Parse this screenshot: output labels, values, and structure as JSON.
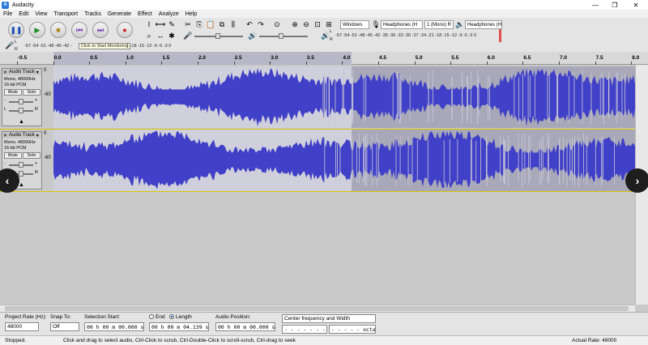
{
  "window": {
    "title": "Audacity",
    "app_icon": "audacity-icon"
  },
  "menu": [
    "File",
    "Edit",
    "View",
    "Transport",
    "Tracks",
    "Generate",
    "Effect",
    "Analyze",
    "Help"
  ],
  "toolbar": {
    "buttons": [
      "pause-icon",
      "play-icon",
      "stop-icon",
      "skip-start-icon",
      "skip-end-icon",
      "record-icon"
    ],
    "host": "Windows",
    "playback_device": "Headphones (H",
    "channels": "1 (Mono) R",
    "recording_device": "Headphones (H",
    "record_meter_scale": "-57 -54 -51 -48 -45 -42 -",
    "monitor_tooltip": "Click to Start Monitoring",
    "monitor_scale_tail": "1 -18 -15 -12 -9 -6 -3 0",
    "play_meter_scale": "-57 -54 -51 -48 -45 -42 -39 -36 -33 -30 -27 -24 -21 -18 -15 -12 -9 -6 -3 0",
    "meter_letters": {
      "left": "L",
      "right": "R"
    },
    "mic_meter_label": "R"
  },
  "ruler": {
    "labels": [
      "-0.5",
      "0.0",
      "0.5",
      "1.0",
      "1.5",
      "2.0",
      "2.5",
      "3.0",
      "3.5",
      "4.0",
      "4.5",
      "5.0",
      "5.5",
      "6.0",
      "6.5",
      "7.0",
      "7.5",
      "8.0"
    ]
  },
  "tracks": [
    {
      "name": "Audio Track",
      "format": "Mono, 48000Hz",
      "depth": "16-bit PCM",
      "mute": "Mute",
      "solo": "Solo",
      "scale_top": "0",
      "scale_mid": "-60",
      "gain_l": "L",
      "gain_r": "R",
      "pan_minus": "-",
      "pan_plus": "+"
    },
    {
      "name": "Audio Track",
      "format": "Mono, 48000Hz",
      "depth": "16-bit PCM",
      "mute": "Mute",
      "solo": "Solo",
      "scale_top": "0",
      "scale_mid": "-60",
      "gain_l": "L",
      "gain_r": "R",
      "pan_minus": "-",
      "pan_plus": "+"
    }
  ],
  "selection": {
    "rate_label": "Project Rate (Hz):",
    "rate_value": "48000",
    "snap_label": "Snap To:",
    "snap_value": "Off",
    "start_label": "Selection Start:",
    "start_value": "00 h 00 m 00.000 s",
    "end_label": "End",
    "length_label": "Length",
    "length_value": "00 h 00 m 04.139 s",
    "position_label": "Audio Position:",
    "position_value": "00 h 00 m 00.000 s",
    "spectral_mode": "Center frequency and Width",
    "freq_value": "- - - - - - - Hz",
    "octaves_value": "- - - - - octaves"
  },
  "status": {
    "state": "Stopped.",
    "hint": "Click and drag to select audio, Ctrl-Click to scrub, Ctrl-Double-Click to scroll-scrub, Ctrl-drag to seek",
    "rate": "Actual Rate: 48000"
  },
  "colors": {
    "waveform": "#4040c8",
    "selection": "#d0d0dc",
    "background": "#a8a8b8"
  },
  "nav": {
    "prev": "‹",
    "next": "›"
  }
}
